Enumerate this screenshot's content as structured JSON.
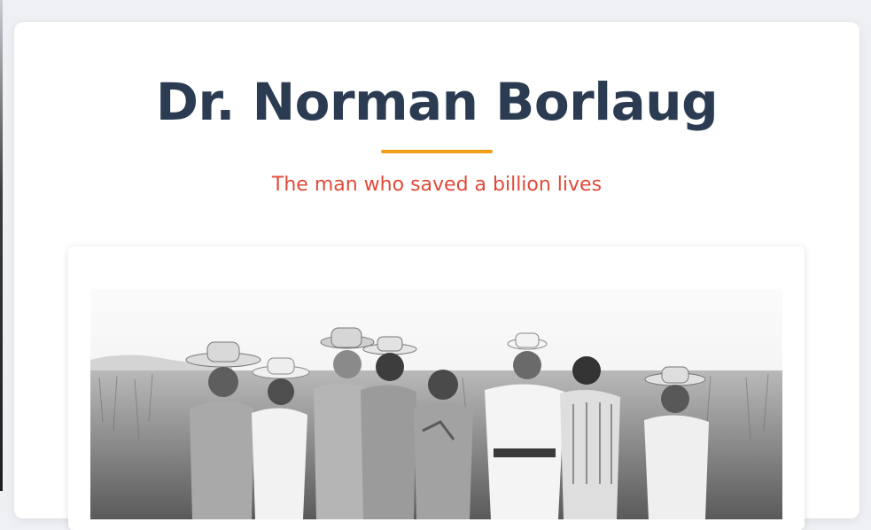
{
  "header": {
    "title": "Dr. Norman Borlaug",
    "subtitle": "The man who saved a billion lives"
  },
  "colors": {
    "title": "#2b3b52",
    "accent_underline": "#f09d17",
    "subtitle": "#e04a38",
    "page_background": "#eef0f4",
    "card_background": "#ffffff"
  },
  "image": {
    "kind": "black-and-white photograph",
    "subject_icon": "group-of-people-in-wheat-field"
  }
}
